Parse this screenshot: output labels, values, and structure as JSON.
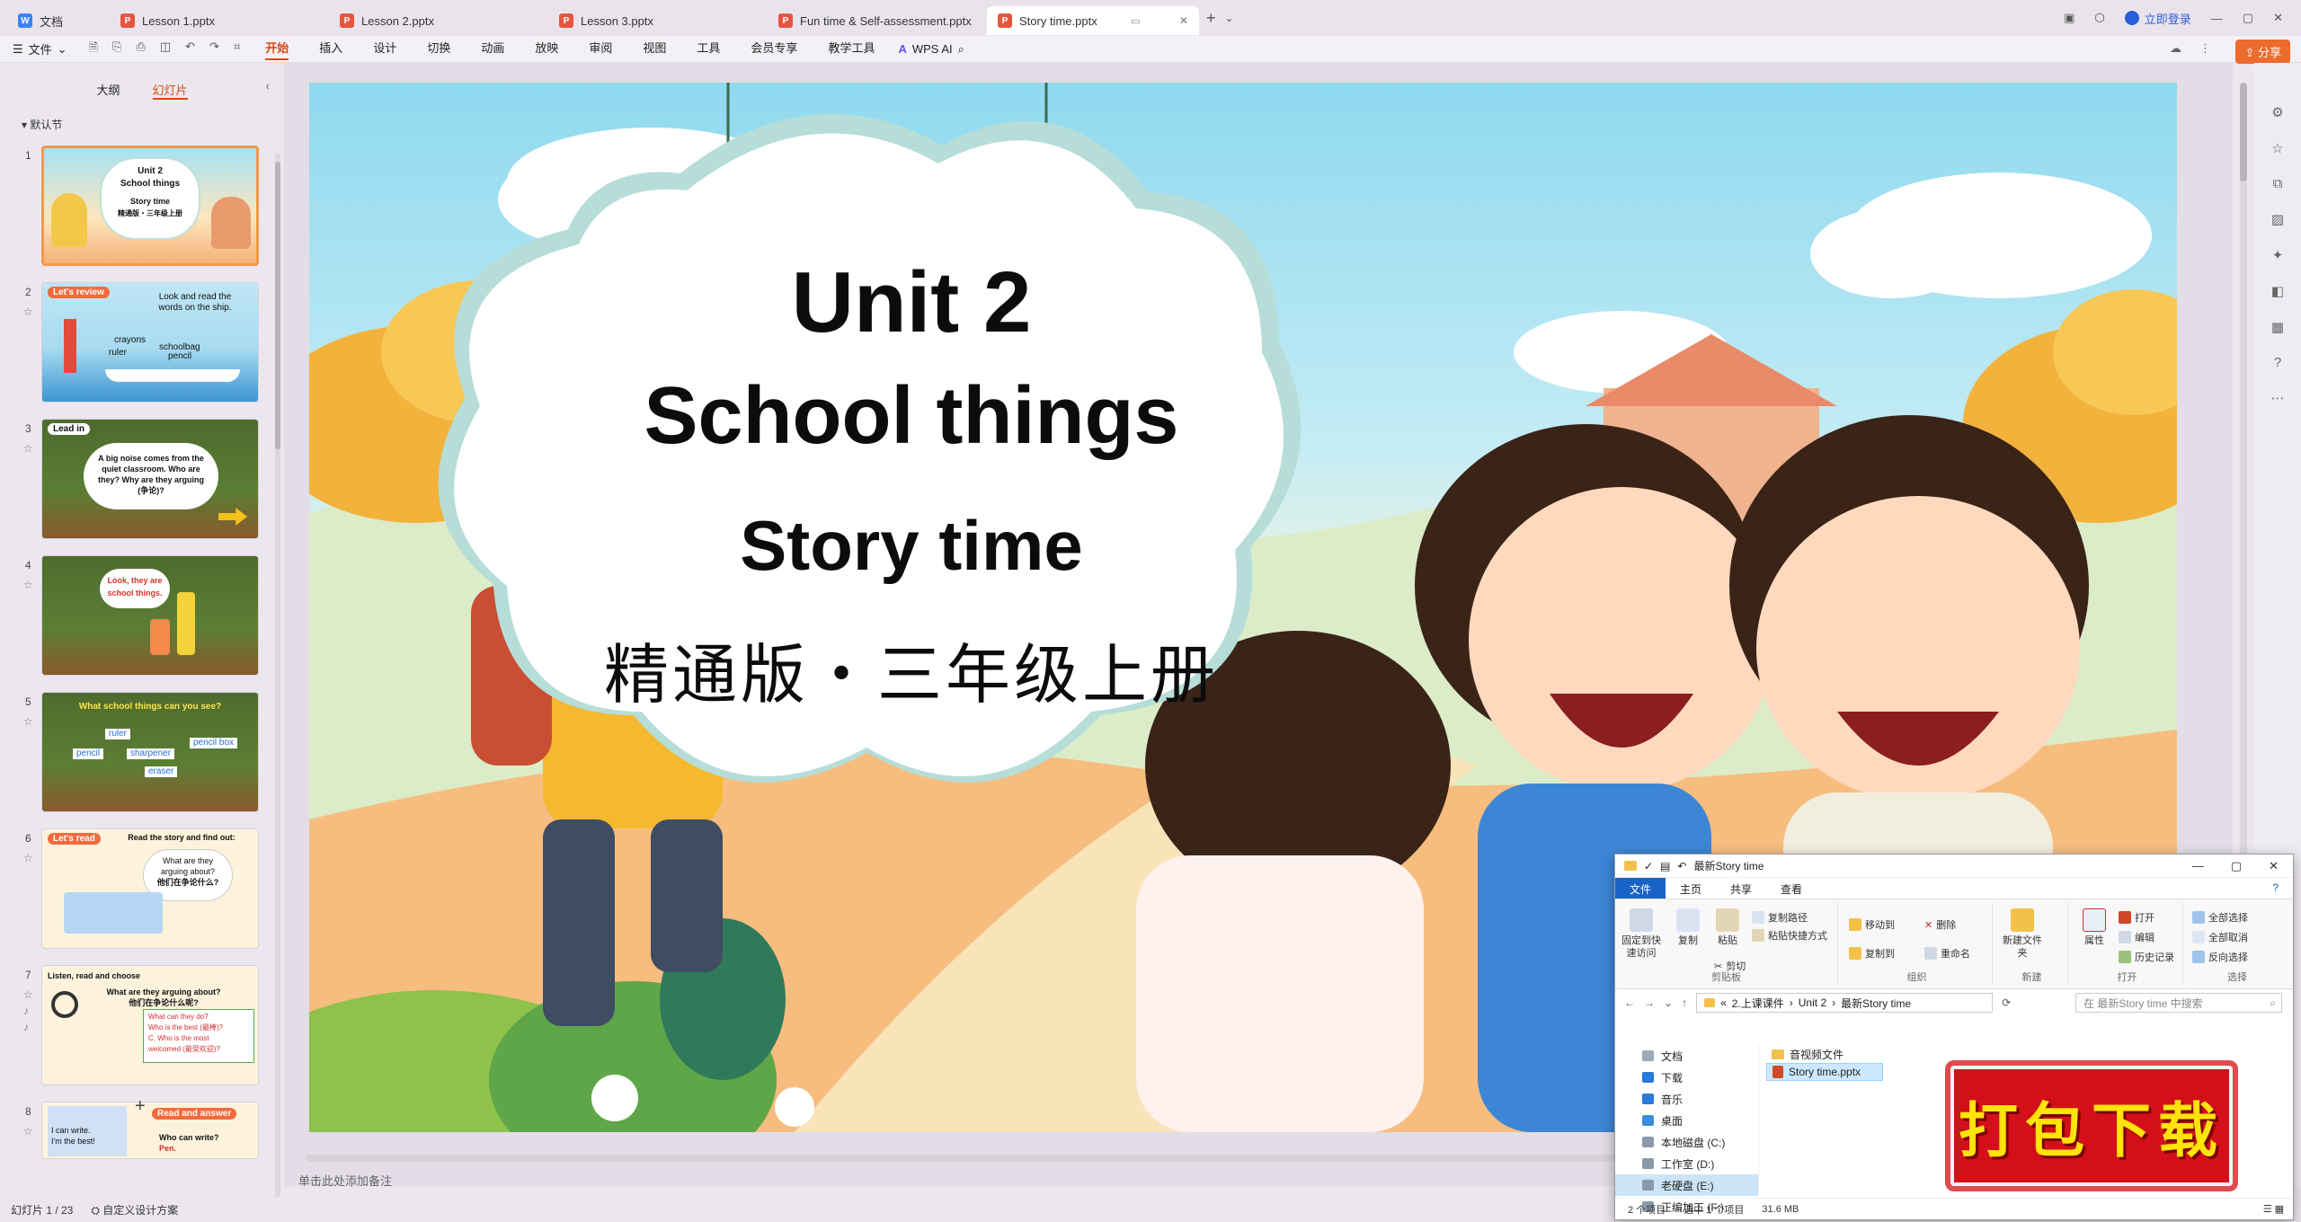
{
  "tabs": [
    {
      "label": "文档",
      "type": "doc"
    },
    {
      "label": "Lesson 1.pptx",
      "type": "ppt"
    },
    {
      "label": "Lesson 2.pptx",
      "type": "ppt"
    },
    {
      "label": "Lesson 3.pptx",
      "type": "ppt"
    },
    {
      "label": "Fun time & Self-assessment.pptx",
      "type": "ppt"
    },
    {
      "label": "Story time.pptx",
      "type": "ppt",
      "active": true
    }
  ],
  "login_label": "立即登录",
  "share_label": "分享",
  "ribbon": {
    "file_label": "文件",
    "menu": [
      "开始",
      "插入",
      "设计",
      "切换",
      "动画",
      "放映",
      "审阅",
      "视图",
      "工具",
      "会员专享",
      "教学工具"
    ],
    "active_menu": "开始",
    "wps_ai_label": "WPS AI"
  },
  "left_panel": {
    "tab_outline": "大纲",
    "tab_slides": "幻灯片",
    "section": "默认节",
    "slides": [
      {
        "num": "1",
        "lines": [
          "Unit 2",
          "School things",
          "Story time",
          "精通版・三年级上册"
        ]
      },
      {
        "num": "2",
        "badge": "Let's review",
        "lines": [
          "Look and read the",
          "words on the ship.",
          "crayons",
          "schoolbag",
          "ruler",
          "pencil"
        ]
      },
      {
        "num": "3",
        "badge": "Lead in",
        "lines": [
          "A big noise comes from the",
          "quiet classroom. Who are",
          "they? Why are they arguing",
          "(争论)?"
        ]
      },
      {
        "num": "4",
        "lines": [
          "Look, they are",
          "school things."
        ]
      },
      {
        "num": "5",
        "lines": [
          "What school things can you see?",
          "ruler",
          "pencil",
          "sharpener",
          "pencil box",
          "eraser"
        ]
      },
      {
        "num": "6",
        "badge": "Let's read",
        "lines": [
          "Read the story and find out:",
          "What are they",
          "arguing about?",
          "他们在争论什么?"
        ]
      },
      {
        "num": "7",
        "lines": [
          "Listen, read and choose",
          "What are they arguing about?",
          "他们在争论什么呢?",
          "What can they do?",
          "Who is the best (最棒)?",
          "C. Who is the most",
          "welcomed (最受欢迎)?"
        ]
      },
      {
        "num": "8",
        "badge": "Read and answer",
        "lines": [
          "I can write.",
          "I'm the best!",
          "Who can write?",
          "Pen."
        ]
      }
    ]
  },
  "slide": {
    "title1": "Unit 2",
    "title2": "School things",
    "title3": "Story time",
    "title4": "精通版・三年级上册"
  },
  "notes_placeholder": "单击此处添加备注",
  "status": {
    "slide_counter": "幻灯片 1 / 23",
    "design_label": "自定义设计方案"
  },
  "explorer": {
    "title": "最新Story time",
    "tabs": [
      "文件",
      "主页",
      "共享",
      "查看"
    ],
    "groups": {
      "clipboard": {
        "label": "剪贴板",
        "pin": "固定到快速访问",
        "copy": "复制",
        "paste": "粘贴",
        "copy_path": "复制路径",
        "paste_shortcut": "粘贴快捷方式",
        "cut": "剪切"
      },
      "organize": {
        "label": "组织",
        "move_to": "移动到",
        "delete": "删除",
        "copy_to": "复制到",
        "rename": "重命名"
      },
      "new": {
        "label": "新建",
        "new_folder": "新建文件夹"
      },
      "open": {
        "label": "打开",
        "properties": "属性",
        "open": "打开",
        "edit": "编辑",
        "history": "历史记录"
      },
      "select": {
        "label": "选择",
        "select_all": "全部选择",
        "select_none": "全部取消",
        "invert": "反向选择"
      }
    },
    "path": [
      "2.上课课件",
      "Unit 2",
      "最新Story time"
    ],
    "search_placeholder": "在 最新Story time 中搜索",
    "nav": [
      "文档",
      "下载",
      "音乐",
      "桌面",
      "本地磁盘 (C:)",
      "工作室 (D:)",
      "老硬盘 (E:)",
      "正编加工 (F:)"
    ],
    "files": [
      {
        "name": "音视频文件",
        "type": "folder"
      },
      {
        "name": "Story time.pptx",
        "type": "pptx",
        "selected": true
      }
    ],
    "status_count": "2 个项目",
    "status_selected": "选中 1 个项目",
    "status_size": "31.6 MB"
  },
  "download_stamp": "打包下载",
  "colors": {
    "accent": "#d9480f",
    "share": "#ec6b2d",
    "ppt_icon": "#e8553f",
    "explorer_blue": "#1a63c6",
    "stamp_red": "#d3101a",
    "stamp_text": "#ffe30a"
  }
}
